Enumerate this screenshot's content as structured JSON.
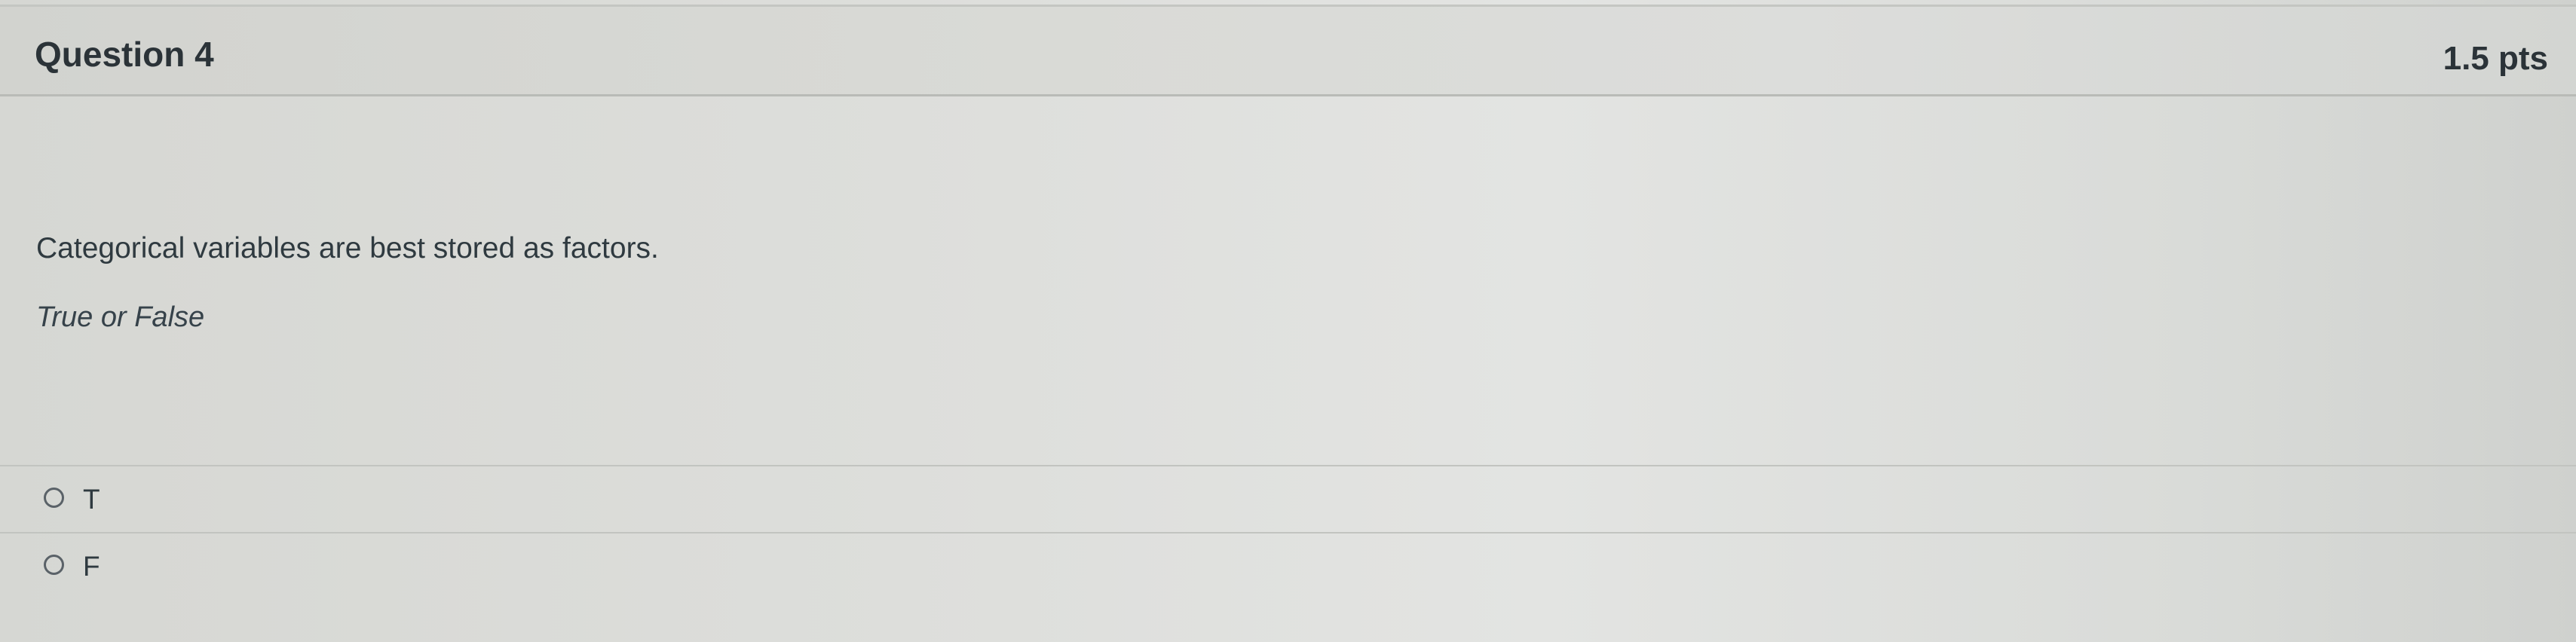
{
  "question": {
    "title": "Question 4",
    "points": "1.5 pts",
    "text": "Categorical variables are best stored as factors.",
    "hint": "True or False",
    "answers": [
      {
        "label": "T",
        "selected": false
      },
      {
        "label": "F",
        "selected": false
      }
    ]
  },
  "colors": {
    "text": "#2d3b45",
    "header_bg": "#d9dad6",
    "divider": "#c2c4c0"
  }
}
